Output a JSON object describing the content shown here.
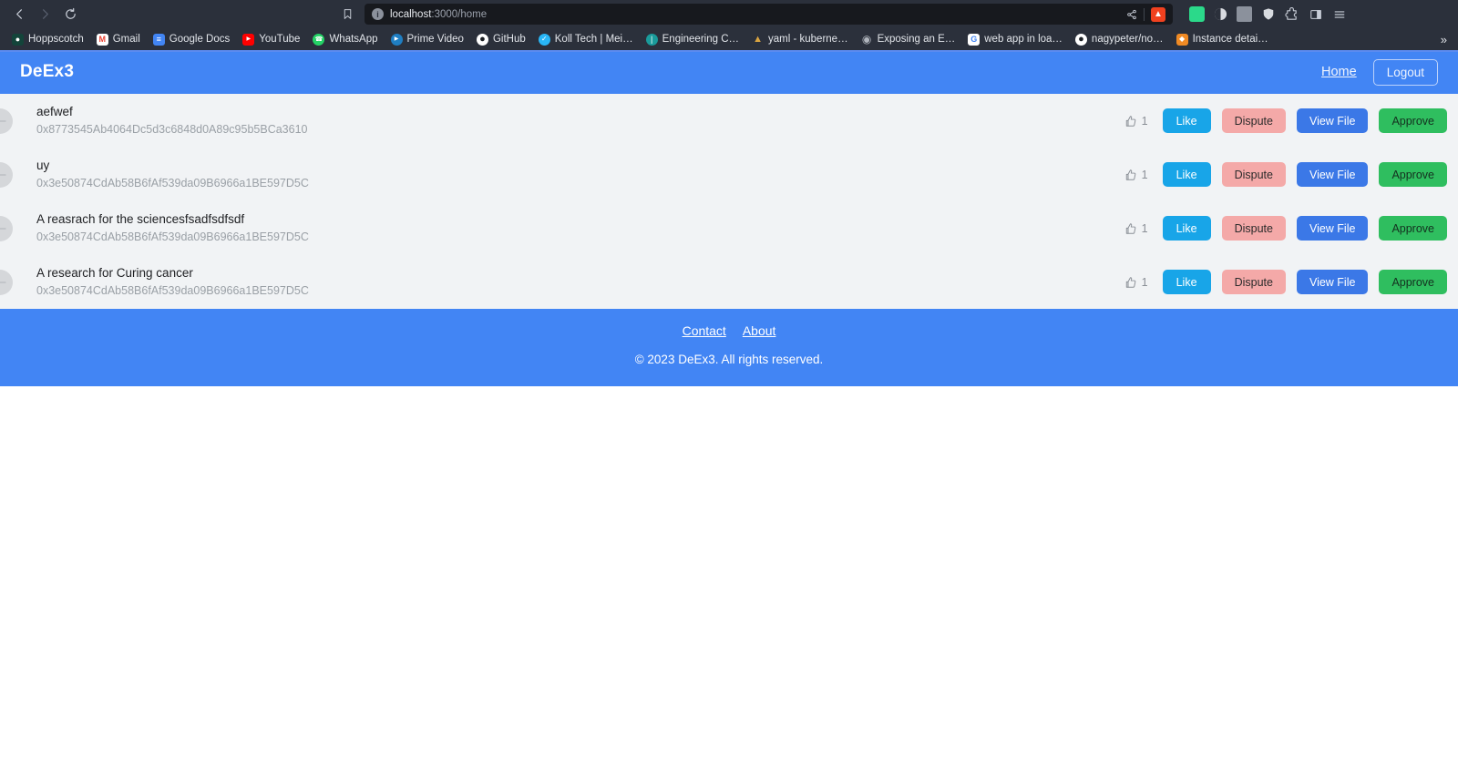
{
  "browser": {
    "nav": {
      "back_icon": "back-arrow-icon",
      "forward_icon": "forward-arrow-icon",
      "reload_icon": "reload-icon",
      "bookmark_icon": "bookmark-icon"
    },
    "url": {
      "host": "localhost",
      "path": ":3000/home",
      "full": "localhost:3000/home",
      "site_info_icon": "site-info-icon",
      "share_icon": "share-icon",
      "brave_icon": "brave-shields-icon"
    },
    "toolbar_icons": [
      "extension-green-icon",
      "brave-rewards-icon",
      "grayscale-square-icon",
      "shield-icon",
      "puzzle-piece-icon",
      "sidebar-panel-icon",
      "hamburger-menu-icon"
    ],
    "bookmarks": [
      {
        "label": "Hoppscotch",
        "color": "#13443a",
        "glyph": "H"
      },
      {
        "label": "Gmail",
        "color": "#ffffff",
        "glyph": "M"
      },
      {
        "label": "Google Docs",
        "color": "#4285f4",
        "glyph": "≡"
      },
      {
        "label": "YouTube",
        "color": "#ff0000",
        "glyph": "▶"
      },
      {
        "label": "WhatsApp",
        "color": "#25d366",
        "glyph": "✆"
      },
      {
        "label": "Prime Video",
        "color": "#1f7ec2",
        "glyph": "▶"
      },
      {
        "label": "GitHub",
        "color": "#ffffff",
        "glyph": "●"
      },
      {
        "label": "Koll Tech | Mei…",
        "color": "#29b6f6",
        "glyph": "✓"
      },
      {
        "label": "Engineering C…",
        "color": "#1a9b9b",
        "glyph": "|"
      },
      {
        "label": "yaml - kuberne…",
        "color": "#d9a441",
        "glyph": "▲"
      },
      {
        "label": "Exposing an E…",
        "color": "#b0b5bd",
        "glyph": "○"
      },
      {
        "label": "web app in loa…",
        "color": "#ffffff",
        "glyph": "G"
      },
      {
        "label": "nagypeter/no…",
        "color": "#ffffff",
        "glyph": "●"
      },
      {
        "label": "Instance detai…",
        "color": "#f08a24",
        "glyph": "◆"
      }
    ],
    "bookmarks_overflow": "»"
  },
  "app": {
    "brand": "DeEx3",
    "nav": {
      "home": "Home",
      "logout": "Logout"
    },
    "rows": [
      {
        "title": "aefwef",
        "address": "0x8773545Ab4064Dc5d3c6848d0A89c95b5BCa3610",
        "likes": "1",
        "like_label": "Like",
        "dispute_label": "Dispute",
        "view_label": "View File",
        "approve_label": "Approve"
      },
      {
        "title": "uy",
        "address": "0x3e50874CdAb58B6fAf539da09B6966a1BE597D5C",
        "likes": "1",
        "like_label": "Like",
        "dispute_label": "Dispute",
        "view_label": "View File",
        "approve_label": "Approve"
      },
      {
        "title": "A reasrach for the sciencesfsadfsdfsdf",
        "address": "0x3e50874CdAb58B6fAf539da09B6966a1BE597D5C",
        "likes": "1",
        "like_label": "Like",
        "dispute_label": "Dispute",
        "view_label": "View File",
        "approve_label": "Approve"
      },
      {
        "title": "A research for Curing cancer",
        "address": "0x3e50874CdAb58B6fAf539da09B6966a1BE597D5C",
        "likes": "1",
        "like_label": "Like",
        "dispute_label": "Dispute",
        "view_label": "View File",
        "approve_label": "Approve"
      }
    ],
    "footer": {
      "contact": "Contact",
      "about": "About",
      "copyright": "© 2023 DeEx3. All rights reserved."
    }
  },
  "colors": {
    "brand_blue": "#4285f4",
    "like_blue": "#18a5e8",
    "dispute_pink": "#f4a9a8",
    "view_blue": "#3b78e7",
    "approve_green": "#2fbe5f",
    "chrome_dark": "#2b303b",
    "page_bg": "#f1f3f5"
  }
}
